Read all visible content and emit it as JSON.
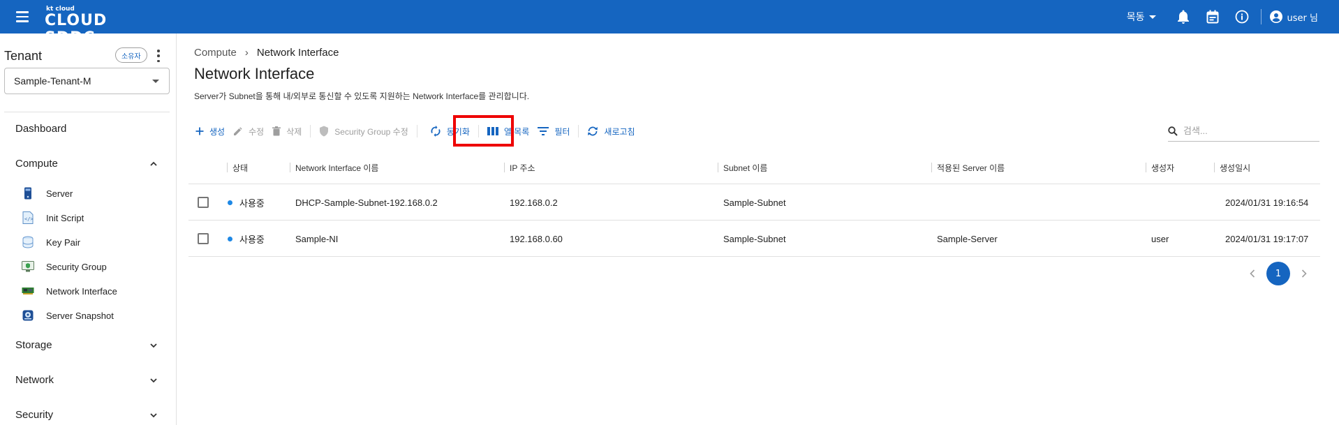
{
  "header": {
    "logo_small": "kt cloud",
    "logo_big": "CLOUD SDDC",
    "region": "목동",
    "user": "user 님"
  },
  "sidebar": {
    "tenant_title": "Tenant",
    "owner_badge": "소유자",
    "tenant_selected": "Sample-Tenant-M",
    "dashboard": "Dashboard",
    "compute": "Compute",
    "compute_items": [
      {
        "label": "Server",
        "icon": "server-icon"
      },
      {
        "label": "Init Script",
        "icon": "script-icon"
      },
      {
        "label": "Key Pair",
        "icon": "key-pair-icon"
      },
      {
        "label": "Security Group",
        "icon": "security-group-icon"
      },
      {
        "label": "Network Interface",
        "icon": "network-interface-icon"
      },
      {
        "label": "Server Snapshot",
        "icon": "snapshot-icon"
      }
    ],
    "storage": "Storage",
    "network": "Network",
    "security": "Security"
  },
  "breadcrumb": {
    "parent": "Compute",
    "current": "Network Interface"
  },
  "page": {
    "title": "Network Interface",
    "description": "Server가 Subnet을 통해 내/외부로 통신할 수 있도록 지원하는 Network Interface를 관리합니다."
  },
  "toolbar": {
    "create": "생성",
    "edit": "수정",
    "delete": "삭제",
    "security_group_edit": "Security Group 수정",
    "sync": "동기화",
    "columns": "열 목록",
    "filter": "필터",
    "refresh": "새로고침"
  },
  "search": {
    "placeholder": "검색..."
  },
  "table": {
    "headers": [
      "상태",
      "Network Interface 이름",
      "IP 주소",
      "Subnet 이름",
      "적용된 Server 이름",
      "생성자",
      "생성일시"
    ],
    "rows": [
      {
        "status": "사용중",
        "name": "DHCP-Sample-Subnet-192.168.0.2",
        "ip": "192.168.0.2",
        "subnet": "Sample-Subnet",
        "server": "",
        "creator": "",
        "created": "2024/01/31 19:16:54"
      },
      {
        "status": "사용중",
        "name": "Sample-NI",
        "ip": "192.168.0.60",
        "subnet": "Sample-Subnet",
        "server": "Sample-Server",
        "creator": "user",
        "created": "2024/01/31 19:17:07"
      }
    ]
  },
  "pagination": {
    "current": "1"
  },
  "colors": {
    "brand": "#1565c0",
    "status_dot": "#1e88e5",
    "highlight": "#ee0000"
  }
}
